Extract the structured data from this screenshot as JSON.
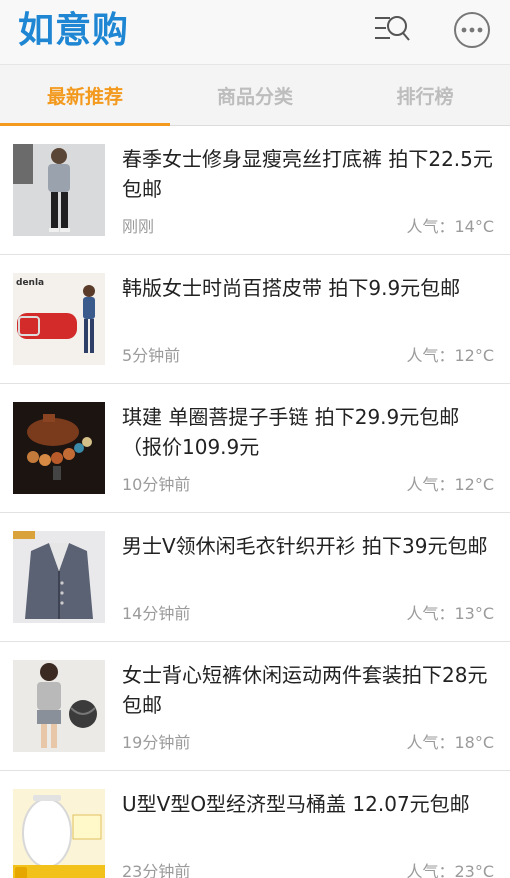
{
  "app": {
    "logo": "如意购"
  },
  "header": {
    "search_icon": "search-list-icon",
    "more_icon": "more-dots-icon"
  },
  "tabs": [
    {
      "label": "最新推荐",
      "active": true
    },
    {
      "label": "商品分类",
      "active": false
    },
    {
      "label": "排行榜",
      "active": false
    }
  ],
  "items": [
    {
      "title": "春季女士修身显瘦亮丝打底裤 拍下22.5元包邮",
      "time": "刚刚",
      "popularity": "人气：14°C",
      "thumb": "woman-leggings-image"
    },
    {
      "title": "韩版女士时尚百搭皮带 拍下9.9元包邮",
      "time": "5分钟前",
      "popularity": "人气：12°C",
      "thumb": "red-belt-image",
      "thumb_text": "denla"
    },
    {
      "title": "琪建 单圈菩提子手链 拍下29.9元包邮（报价109.9元",
      "time": "10分钟前",
      "popularity": "人气：12°C",
      "thumb": "bodhi-bracelet-image"
    },
    {
      "title": "男士V领休闲毛衣针织开衫 拍下39元包邮",
      "time": "14分钟前",
      "popularity": "人气：13°C",
      "thumb": "men-cardigan-image"
    },
    {
      "title": "女士背心短裤休闲运动两件套装拍下28元包邮",
      "time": "19分钟前",
      "popularity": "人气：18°C",
      "thumb": "sport-set-image"
    },
    {
      "title": "U型V型O型经济型马桶盖 12.07元包邮",
      "time": "23分钟前",
      "popularity": "人气：23°C",
      "thumb": "toilet-lid-image"
    }
  ],
  "colors": {
    "brand": "#1e86d3",
    "accent": "#f39a1e",
    "muted": "#9b9b9b"
  }
}
